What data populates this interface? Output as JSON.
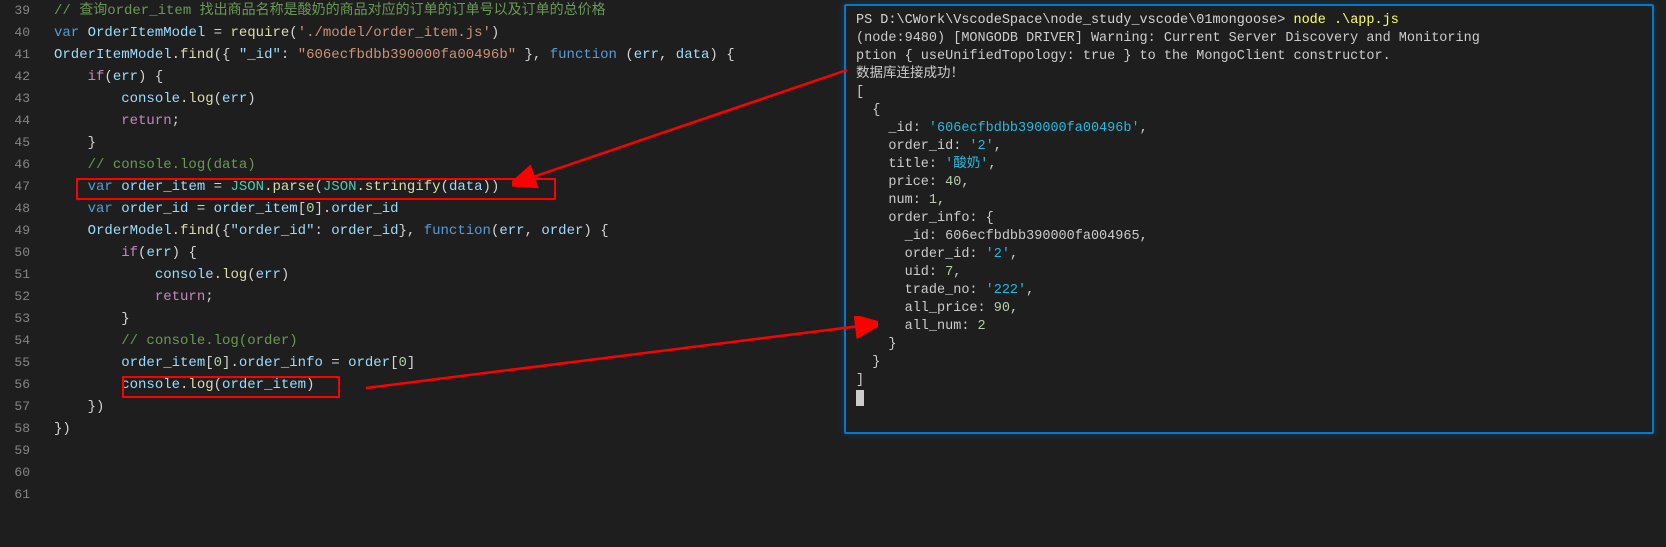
{
  "gutter": {
    "start": 39,
    "end": 61
  },
  "code": {
    "l39": "// 查询order_item 找出商品名称是酸奶的商品对应的订单的订单号以及订单的总价格",
    "l40_var": "var",
    "l40_name": "OrderItemModel",
    "l40_eq": " = ",
    "l40_req": "require",
    "l40_p1": "(",
    "l40_str": "'./model/order_item.js'",
    "l40_p2": ")",
    "l41_model": "OrderItemModel",
    "l41_find": ".find",
    "l41_p1": "({ ",
    "l41_k": "\"_id\"",
    "l41_c": ": ",
    "l41_v": "\"606ecfbdbb390000fa00496b\"",
    "l41_p2": " }, ",
    "l41_fn": "function",
    "l41_p3": " (",
    "l41_err": "err",
    "l41_cm": ", ",
    "l41_data": "data",
    "l41_p4": ") {",
    "l42_if": "if",
    "l42_p1": "(",
    "l42_err": "err",
    "l42_p2": ") {",
    "l43_cl": "console",
    "l43_log": ".log",
    "l43_p1": "(",
    "l43_err": "err",
    "l43_p2": ")",
    "l44_ret": "return",
    "l44_sc": ";",
    "l45": "}",
    "l46": "// console.log(data)",
    "l47_var": "var",
    "l47_oi": " order_item",
    "l47_eq": " = ",
    "l47_json": "JSON",
    "l47_parse": ".parse",
    "l47_p1": "(",
    "l47_json2": "JSON",
    "l47_str": ".stringify",
    "l47_p2": "(",
    "l47_data": "data",
    "l47_p3": "))",
    "l48_var": "var",
    "l48_oid": " order_id",
    "l48_eq": " = ",
    "l48_oi": "order_item",
    "l48_idx": "[",
    "l48_n": "0",
    "l48_idx2": "].",
    "l48_prop": "order_id",
    "l49_om": "OrderModel",
    "l49_find": ".find",
    "l49_p1": "({",
    "l49_k": "\"order_id\"",
    "l49_c": ": ",
    "l49_v": "order_id",
    "l49_p2": "}, ",
    "l49_fn": "function",
    "l49_p3": "(",
    "l49_err": "err",
    "l49_cm": ", ",
    "l49_ord": "order",
    "l49_p4": ") {",
    "l50_if": "if",
    "l50_p1": "(",
    "l50_err": "err",
    "l50_p2": ") {",
    "l51_cl": "console",
    "l51_log": ".log",
    "l51_p1": "(",
    "l51_err": "err",
    "l51_p2": ")",
    "l52_ret": "return",
    "l52_sc": ";",
    "l53": "}",
    "l54": "// console.log(order)",
    "l55_oi": "order_item",
    "l55_idx": "[",
    "l55_n": "0",
    "l55_idx2": "].",
    "l55_prop": "order_info",
    "l55_eq": " = ",
    "l55_ord": "order",
    "l55_idx3": "[",
    "l55_n2": "0",
    "l55_idx4": "]",
    "l56_cl": "console",
    "l56_log": ".log",
    "l56_p1": "(",
    "l56_oi": "order_item",
    "l56_p2": ")",
    "l57": "})",
    "l58": "})"
  },
  "terminal": {
    "prompt": "PS D:\\CWork\\VscodeSpace\\node_study_vscode\\01mongoose> ",
    "cmd": "node .\\app.js",
    "l2": "(node:9480) [MONGODB DRIVER] Warning: Current Server Discovery and Monitoring",
    "l3": "ption { useUnifiedTopology: true } to the MongoClient constructor.",
    "l4": "数据库连接成功！",
    "l5": "[",
    "l6": "  {",
    "l7a": "    _id: ",
    "l7b": "'606ecfbdbb390000fa00496b'",
    "l7c": ",",
    "l8a": "    order_id: ",
    "l8b": "'2'",
    "l8c": ",",
    "l9a": "    title: ",
    "l9b": "'酸奶'",
    "l9c": ",",
    "l10a": "    price: ",
    "l10b": "40",
    "l10c": ",",
    "l11a": "    num: ",
    "l11b": "1",
    "l11c": ",",
    "l12a": "    order_info: ",
    "l12b": "{",
    "l13a": "      _id: ",
    "l13b": "606ecfbdbb390000fa004965",
    "l13c": ",",
    "l14a": "      order_id: ",
    "l14b": "'2'",
    "l14c": ",",
    "l15a": "      uid: ",
    "l15b": "7",
    "l15c": ",",
    "l16a": "      trade_no: ",
    "l16b": "'222'",
    "l16c": ",",
    "l17a": "      all_price: ",
    "l17b": "90",
    "l17c": ",",
    "l18a": "      all_num: ",
    "l18b": "2",
    "l19": "    }",
    "l20": "  }",
    "l21": "]"
  }
}
